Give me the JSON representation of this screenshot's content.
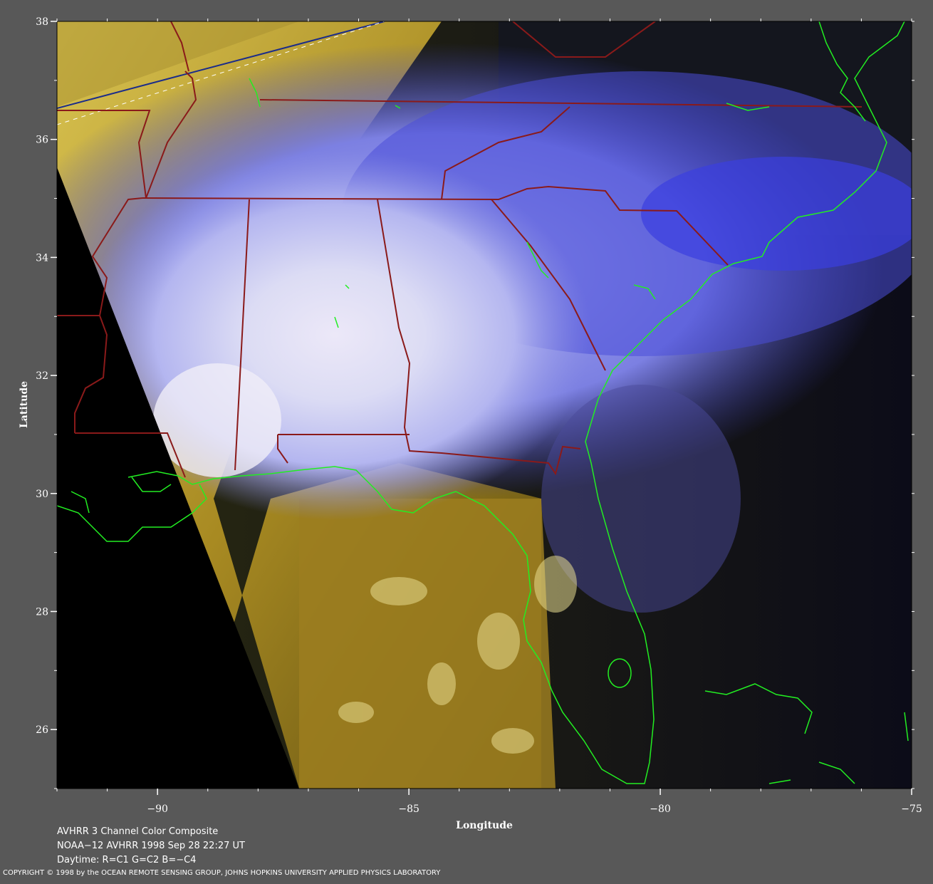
{
  "axes": {
    "x_label": "Longitude",
    "y_label": "Latitude",
    "lon_range": [
      -92,
      -75
    ],
    "lat_range": [
      25,
      38
    ],
    "lon_ticks": [
      -90,
      -85,
      -80,
      -75
    ],
    "lat_ticks": [
      26,
      28,
      30,
      32,
      34,
      36,
      38
    ],
    "lon_tick_labels": [
      "−90",
      "−85",
      "−80",
      "−75"
    ],
    "lat_tick_labels": [
      "26",
      "28",
      "30",
      "32",
      "34",
      "36",
      "38"
    ]
  },
  "caption": {
    "line1": "AVHRR 3 Channel Color Composite",
    "line2": "NOAA−12 AVHRR 1998 Sep 28 22:27 UT",
    "line3": "Daytime: R=C1 G=C2 B=−C4"
  },
  "copyright": "COPYRIGHT © 1998 by the OCEAN REMOTE SENSING GROUP, JOHNS HOPKINS UNIVERSITY APPLIED PHYSICS LABORATORY",
  "colors": {
    "background": "#585858",
    "coastline": "#22ee22",
    "state_borders": "#8a1a1a",
    "clouds": "#8c90ee",
    "sea_glint": "#a88a22",
    "no_data": "#000000"
  },
  "features": {
    "storm": "Hurricane eye near Gulf Coast (approx. -88.5, 31)"
  }
}
